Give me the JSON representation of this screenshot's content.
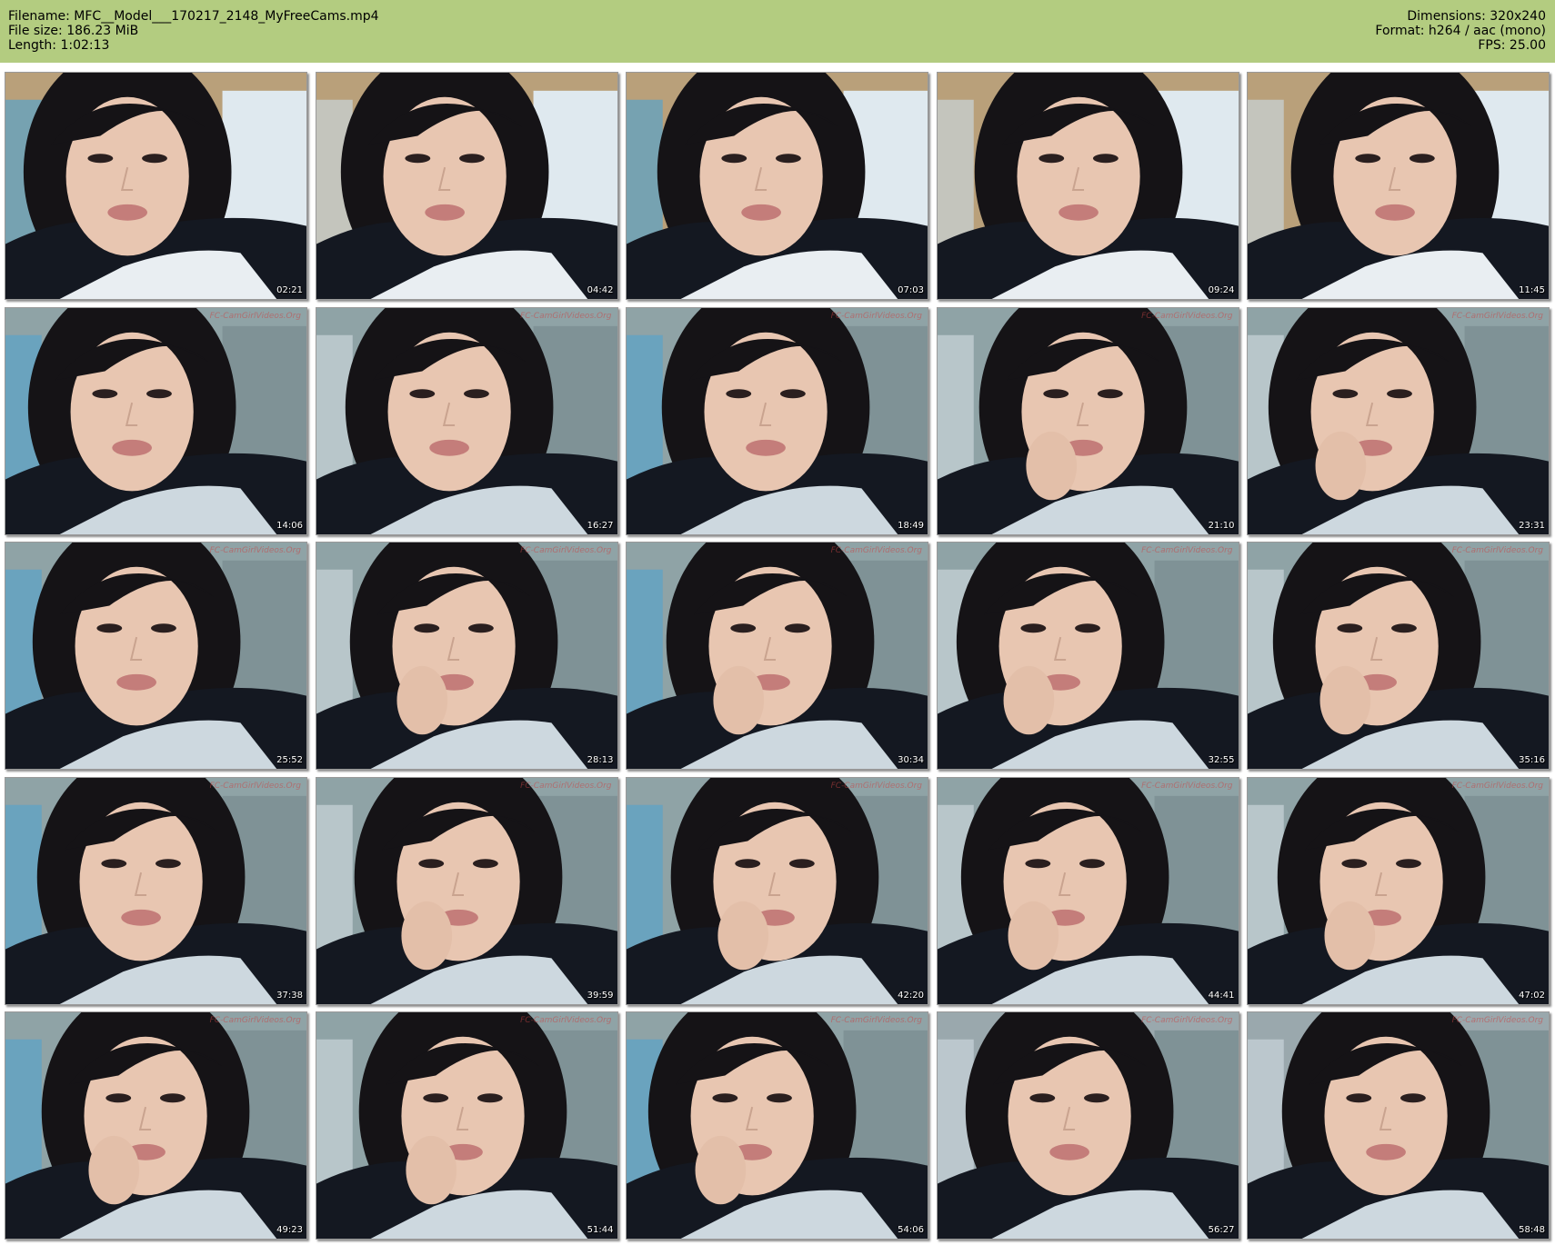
{
  "header": {
    "filename": "Filename: MFC__Model___170217_2148_MyFreeCams.mp4",
    "filesize": "File size: 186.23 MiB",
    "length": "Length: 1:02:13",
    "dimensions": "Dimensions: 320x240",
    "format": "Format: h264 / aac (mono)",
    "fps": "FPS: 25.00"
  },
  "thumbnails": [
    {
      "time": "02:21"
    },
    {
      "time": "04:42"
    },
    {
      "time": "07:03"
    },
    {
      "time": "09:24"
    },
    {
      "time": "11:45"
    },
    {
      "time": "14:06"
    },
    {
      "time": "16:27"
    },
    {
      "time": "18:49"
    },
    {
      "time": "21:10"
    },
    {
      "time": "23:31"
    },
    {
      "time": "25:52"
    },
    {
      "time": "28:13"
    },
    {
      "time": "30:34"
    },
    {
      "time": "32:55"
    },
    {
      "time": "35:16"
    },
    {
      "time": "37:38"
    },
    {
      "time": "39:59"
    },
    {
      "time": "42:20"
    },
    {
      "time": "44:41"
    },
    {
      "time": "47:02"
    },
    {
      "time": "49:23"
    },
    {
      "time": "51:44"
    },
    {
      "time": "54:06"
    },
    {
      "time": "56:27"
    },
    {
      "time": "58:48"
    }
  ],
  "watermark": "FC-CamGirlVideos.Org",
  "colors": {
    "header_bg": "#b3cc80",
    "page_bg": "#ffffff"
  }
}
